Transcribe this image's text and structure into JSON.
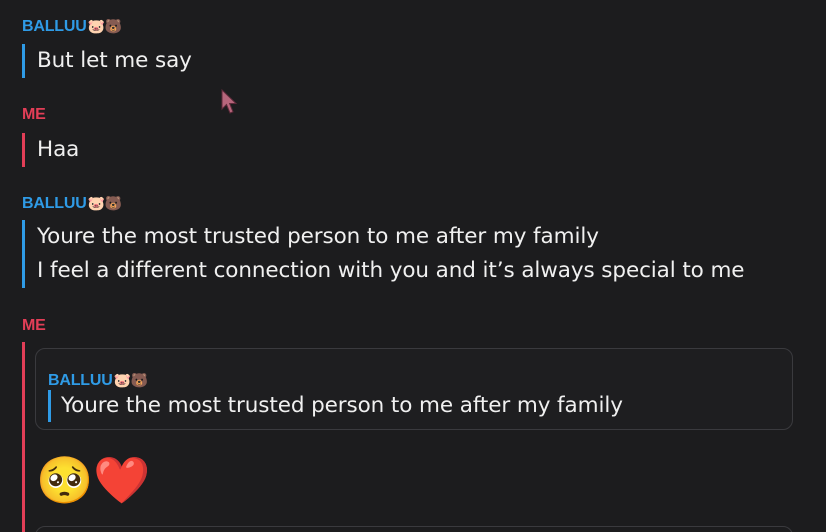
{
  "messages": [
    {
      "sender": "BALLUU",
      "sender_emoji": "🐷🐻",
      "lines": [
        "But let me say"
      ]
    },
    {
      "sender": "ME",
      "lines": [
        "Haa"
      ]
    },
    {
      "sender": "BALLUU",
      "sender_emoji": "🐷🐻",
      "lines": [
        "Youre the most trusted person to me after my family",
        "I feel a different connection with you and it’s always special to me"
      ]
    },
    {
      "sender": "ME",
      "reply": {
        "sender": "BALLUU",
        "sender_emoji": "🐷🐻",
        "text": "Youre the most trusted person to me after my family"
      },
      "reactions": [
        "🥺",
        "❤️"
      ]
    }
  ],
  "colors": {
    "background": "#1c1c1e",
    "balluu": "#2f9be6",
    "me": "#e23e57",
    "text": "#f0f0f0"
  },
  "icons": {
    "cursor": "mouse-pointer-icon"
  }
}
